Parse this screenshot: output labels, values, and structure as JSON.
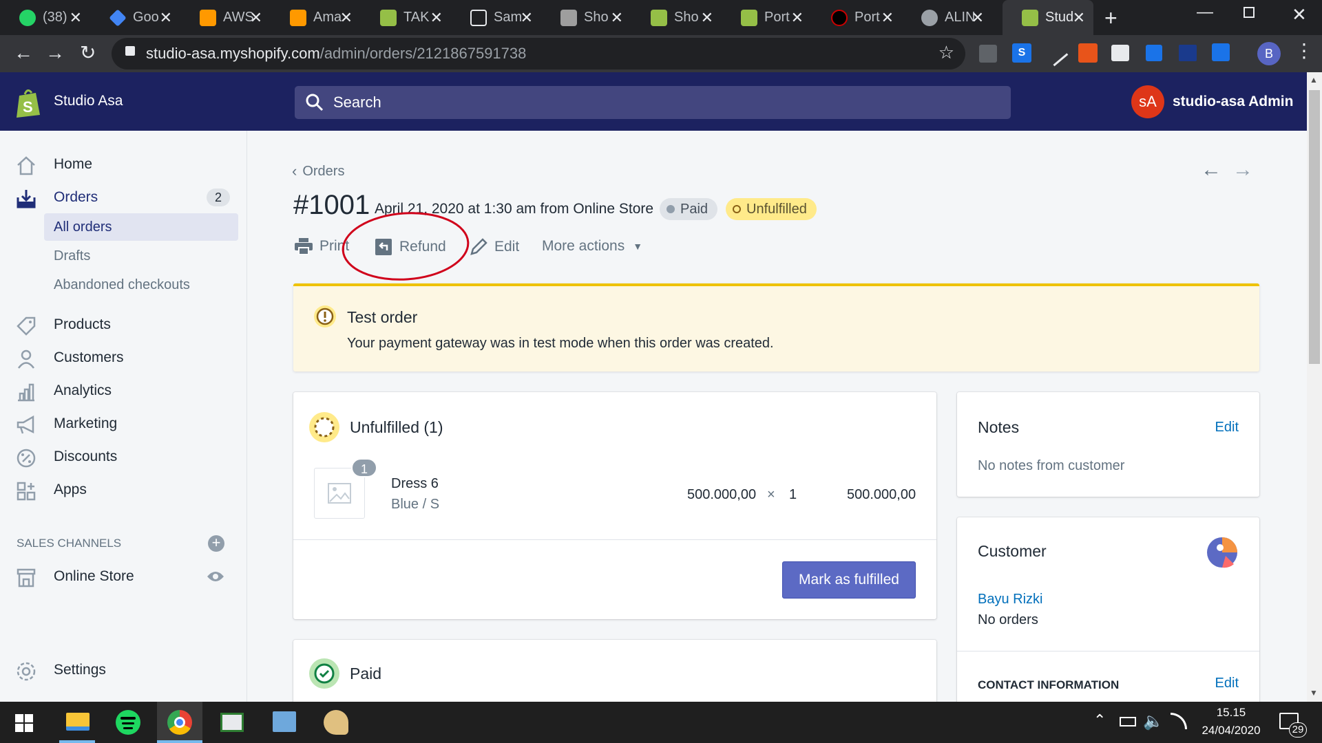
{
  "browser": {
    "tabs": [
      {
        "title": "(38)",
        "favicon_color": "#25d366"
      },
      {
        "title": "Goo",
        "favicon_color": "#4285f4"
      },
      {
        "title": "AWS",
        "favicon_color": "#ff9900"
      },
      {
        "title": "Ama",
        "favicon_color": "#ff9900"
      },
      {
        "title": "TAK",
        "favicon_color": "#95bf47"
      },
      {
        "title": "Sam",
        "favicon_color": "#202124"
      },
      {
        "title": "Sho",
        "favicon_color": "#9e9e9e"
      },
      {
        "title": "Sho",
        "favicon_color": "#95bf47"
      },
      {
        "title": "Port",
        "favicon_color": "#95bf47"
      },
      {
        "title": "Port",
        "favicon_color": "#000000"
      },
      {
        "title": "ALIN",
        "favicon_color": "#9aa0a6"
      },
      {
        "title": "Stud",
        "favicon_color": "#95bf47"
      }
    ],
    "new_tab": "+",
    "url_host": "studio-asa.myshopify.com",
    "url_path": "/admin/orders/2121867591738",
    "profile_initial": "B"
  },
  "store": {
    "name": "Studio Asa",
    "search_placeholder": "Search",
    "avatar_initials": "sA",
    "admin_name": "studio-asa Admin"
  },
  "sidebar": {
    "home": "Home",
    "orders": "Orders",
    "orders_count": "2",
    "all_orders": "All orders",
    "drafts": "Drafts",
    "abandoned": "Abandoned checkouts",
    "products": "Products",
    "customers": "Customers",
    "analytics": "Analytics",
    "marketing": "Marketing",
    "discounts": "Discounts",
    "apps": "Apps",
    "sales_channels": "SALES CHANNELS",
    "online_store": "Online Store",
    "settings": "Settings"
  },
  "order": {
    "breadcrumb": "Orders",
    "number": "#1001",
    "meta": "April 21, 2020 at 1:30 am from Online Store",
    "paid_badge": "Paid",
    "unfulfilled_badge": "Unfulfilled",
    "actions": {
      "print": "Print",
      "refund": "Refund",
      "edit": "Edit",
      "more": "More actions"
    },
    "banner": {
      "title": "Test order",
      "body": "Your payment gateway was in test mode when this order was created."
    },
    "unfulfilled_title": "Unfulfilled (1)",
    "item": {
      "qty_badge": "1",
      "name": "Dress 6",
      "variant": "Blue / S",
      "price": "500.000,00",
      "times": "×",
      "qty": "1",
      "total": "500.000,00"
    },
    "mark_fulfilled": "Mark as fulfilled",
    "paid_title": "Paid"
  },
  "notes": {
    "title": "Notes",
    "edit": "Edit",
    "body": "No notes from customer"
  },
  "customer": {
    "title": "Customer",
    "name": "Bayu Rizki",
    "orders": "No orders",
    "contact_title": "CONTACT INFORMATION",
    "contact_edit": "Edit"
  },
  "taskbar": {
    "time": "15.15",
    "date": "24/04/2020",
    "notif_count": "29"
  },
  "colors": {
    "shop_nav": "#1c2260",
    "primary": "#5c6ac4",
    "annotation": "#d0021b",
    "banner_bg": "#fdf7e3",
    "banner_border": "#eec200"
  }
}
